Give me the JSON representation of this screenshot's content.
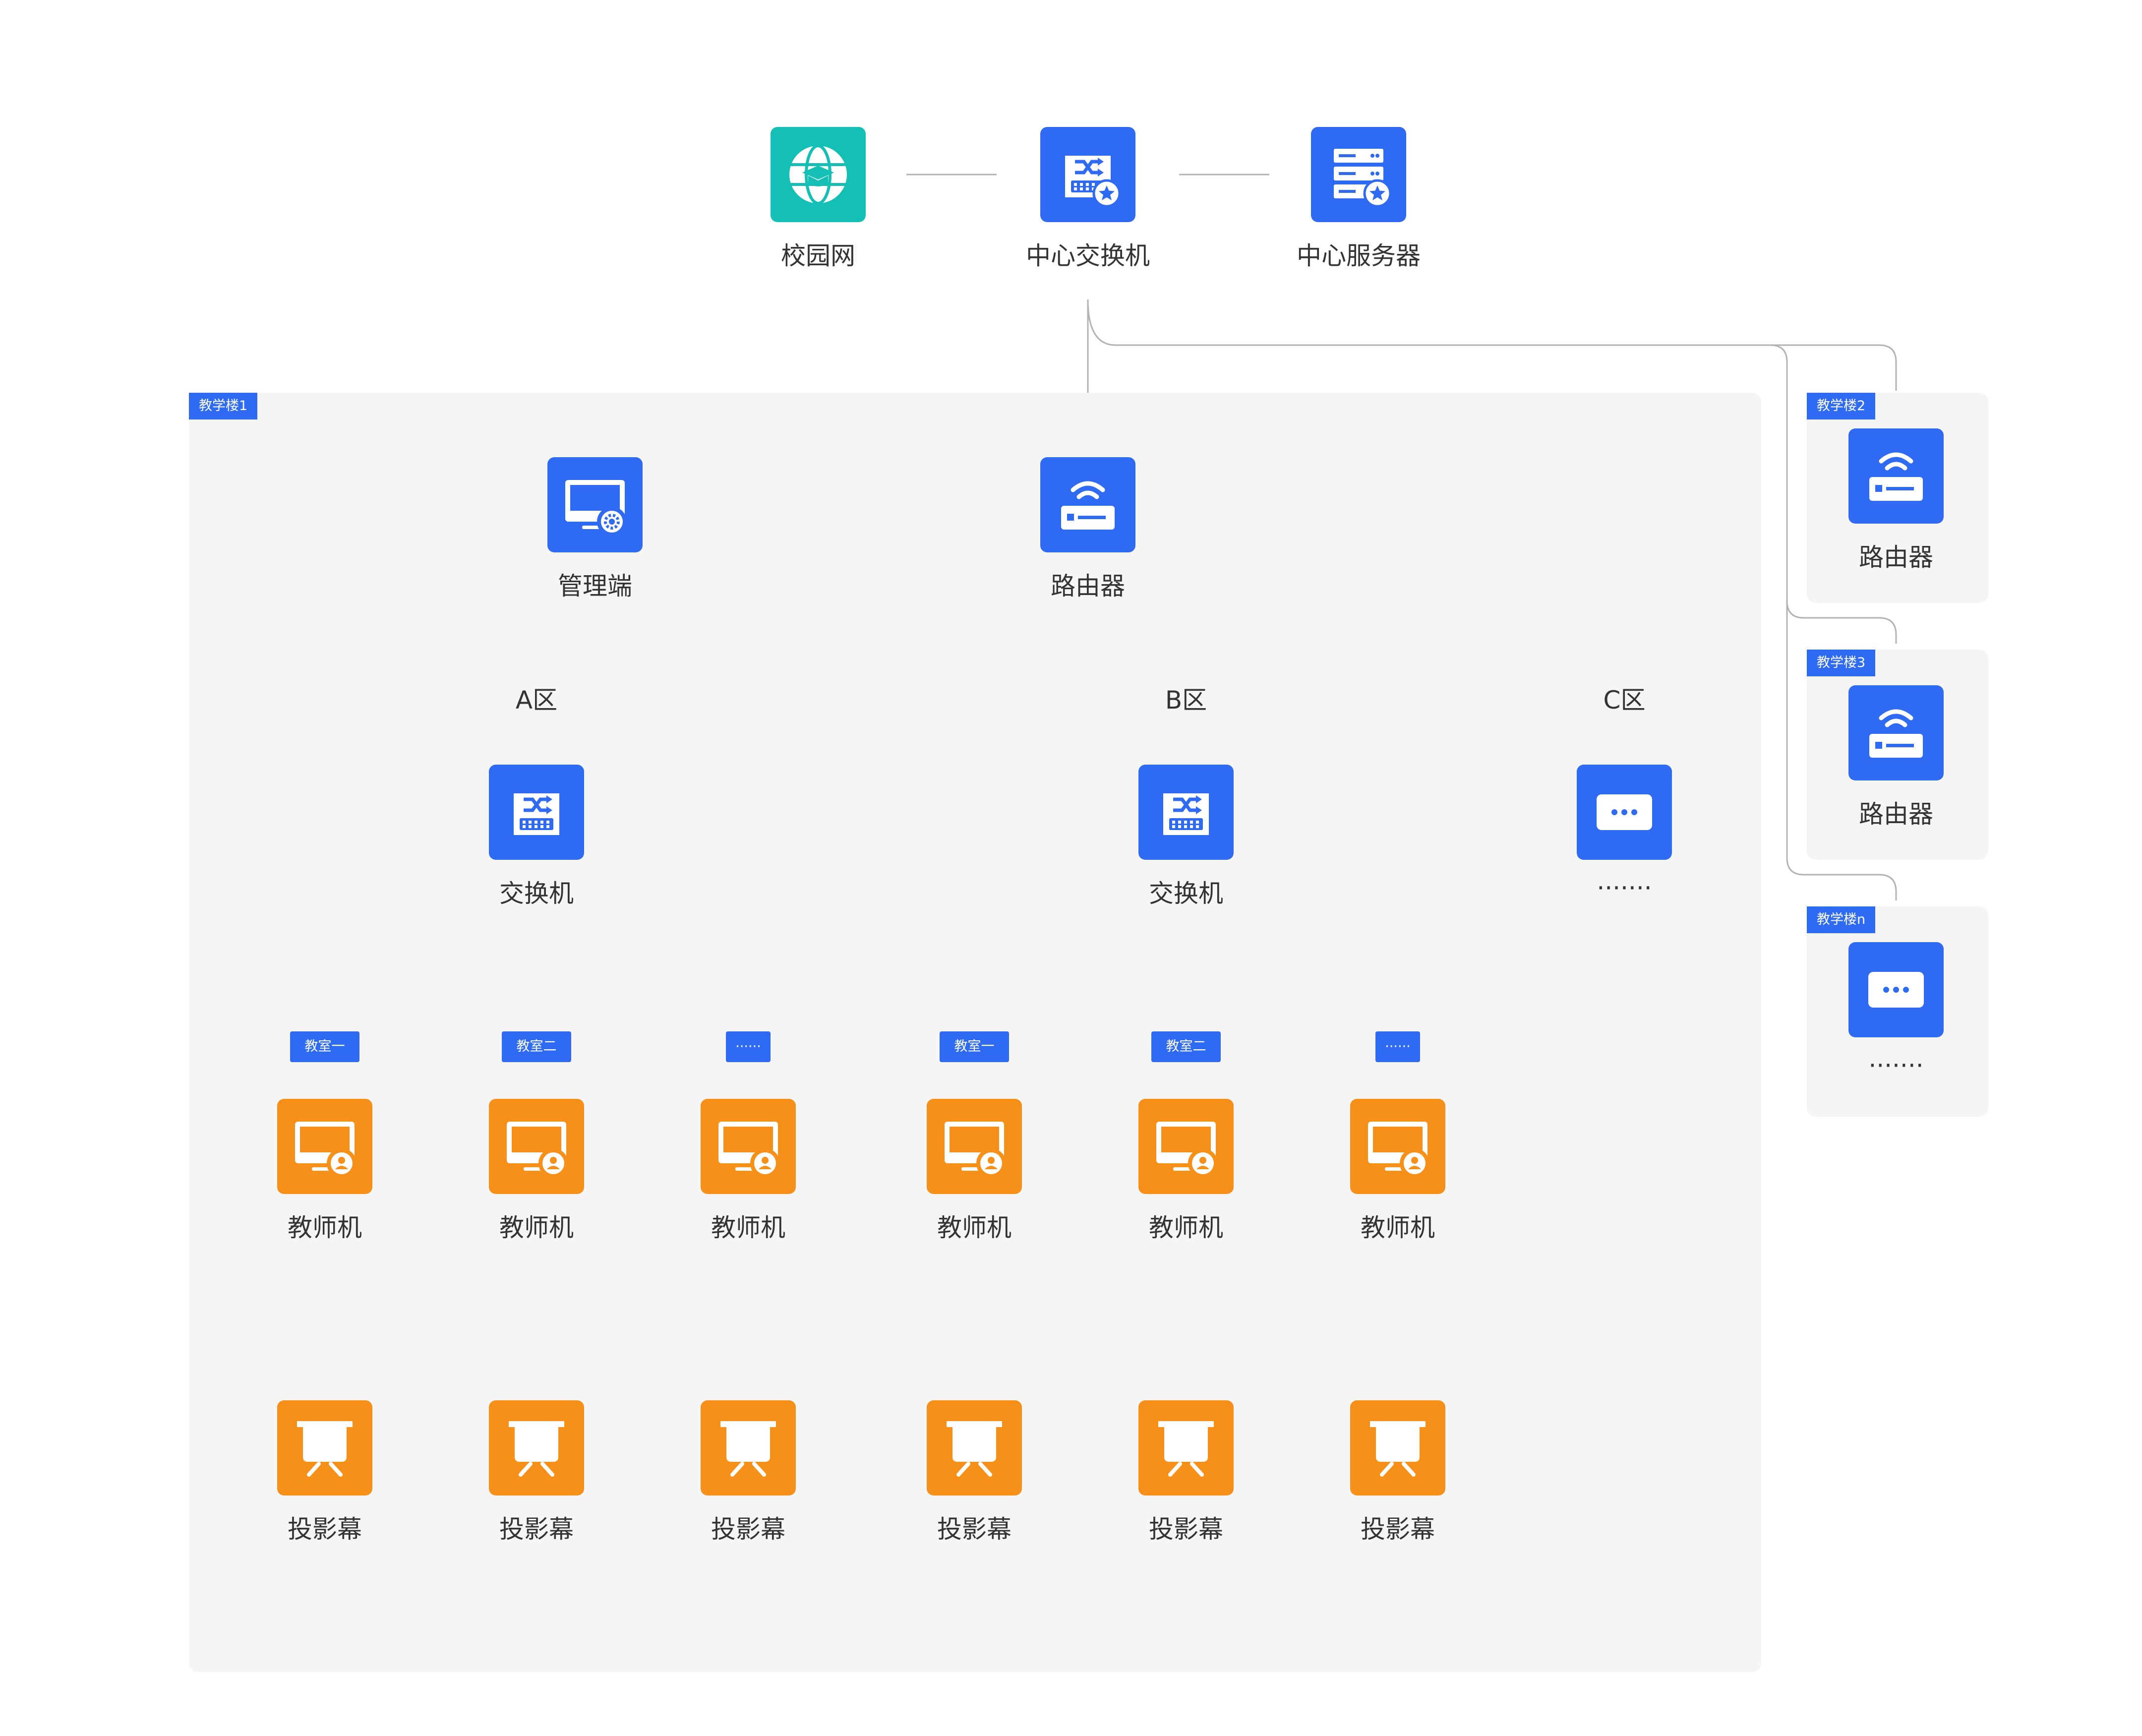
{
  "top": {
    "campus": "校园网",
    "center_switch": "中心交换机",
    "center_server": "中心服务器"
  },
  "building1": {
    "tag": "教学楼1",
    "admin": "管理端",
    "router": "路由器",
    "zones": [
      {
        "label": "A区",
        "switch": "交换机",
        "rooms": [
          {
            "tag": "教室一",
            "teacher": "教师机",
            "screen": "投影幕"
          },
          {
            "tag": "教室二",
            "teacher": "教师机",
            "screen": "投影幕"
          },
          {
            "tag": "······",
            "teacher": "教师机",
            "screen": "投影幕"
          }
        ]
      },
      {
        "label": "B区",
        "switch": "交换机",
        "rooms": [
          {
            "tag": "教室一",
            "teacher": "教师机",
            "screen": "投影幕"
          },
          {
            "tag": "教室二",
            "teacher": "教师机",
            "screen": "投影幕"
          },
          {
            "tag": "······",
            "teacher": "教师机",
            "screen": "投影幕"
          }
        ]
      },
      {
        "label": "C区",
        "more": "·······"
      }
    ]
  },
  "buildings": [
    {
      "tag": "教学楼2",
      "label": "路由器"
    },
    {
      "tag": "教学楼3",
      "label": "路由器"
    },
    {
      "tag": "教学楼n",
      "label": "·······"
    }
  ],
  "colors": {
    "blue": "#2f6bf2",
    "teal": "#14c0b5",
    "orange": "#f79018",
    "panel": "#f5f5f5",
    "line": "#b3b3b3"
  },
  "icons": {
    "campus": "globe-graduation-icon",
    "center_switch": "network-switch-star-icon",
    "center_server": "server-star-icon",
    "admin": "monitor-gear-icon",
    "router": "wifi-router-icon",
    "switch": "network-switch-icon",
    "teacher": "monitor-user-icon",
    "screen": "projector-screen-icon",
    "more": "more-dots-icon"
  }
}
